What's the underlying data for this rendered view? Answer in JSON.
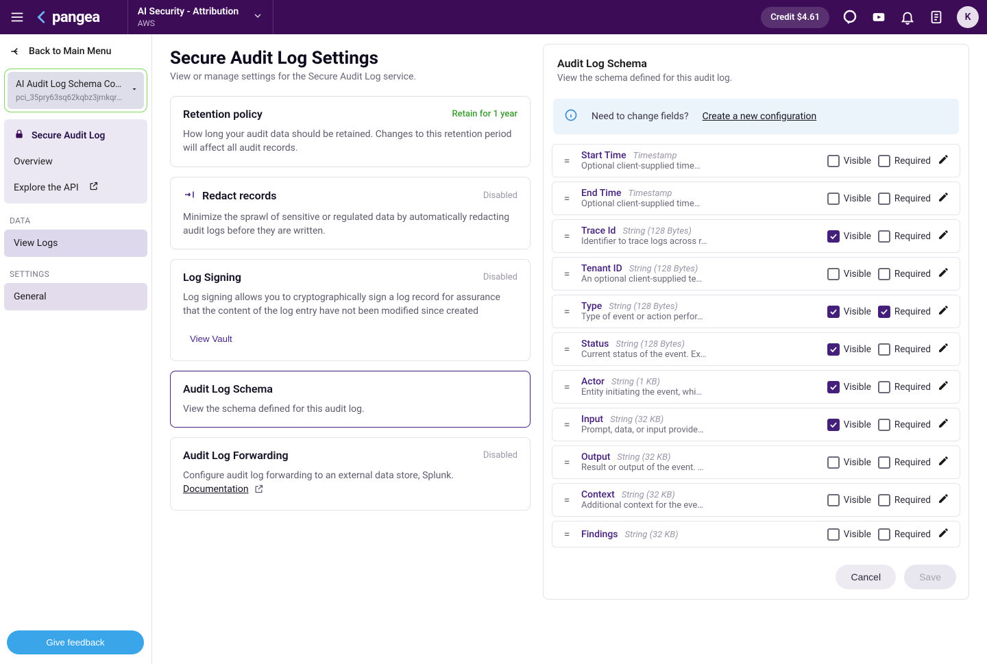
{
  "topbar": {
    "project_title": "AI Security - Attribution",
    "project_sub": "AWS",
    "credit_label": "Credit $4.61",
    "avatar_initial": "K"
  },
  "sidebar": {
    "back_label": "Back to Main Menu",
    "config_name": "AI Audit Log Schema Conf…",
    "config_id": "pci_35pry63sq62kqbz3jmkqrp…",
    "service_label": "Secure Audit Log",
    "overview_label": "Overview",
    "explore_label": "Explore the API",
    "section_data": "DATA",
    "view_logs": "View Logs",
    "section_settings": "SETTINGS",
    "general": "General",
    "feedback": "Give feedback"
  },
  "page": {
    "title": "Secure Audit Log Settings",
    "subtitle": "View or manage settings for the Secure Audit Log service."
  },
  "cards": {
    "retention": {
      "title": "Retention policy",
      "badge": "Retain for 1 year",
      "desc": "How long your audit data should be retained. Changes to this retention period will affect all audit records."
    },
    "redact": {
      "title": "Redact records",
      "badge": "Disabled",
      "desc": "Minimize the sprawl of sensitive or regulated data by automatically redacting audit logs before they are written."
    },
    "signing": {
      "title": "Log Signing",
      "badge": "Disabled",
      "desc": "Log signing allows you to cryptographically sign a log record for assurance that the content of the log entry have not been modified since created",
      "action": "View Vault"
    },
    "schema": {
      "title": "Audit Log Schema",
      "desc": "View the schema defined for this audit log."
    },
    "forwarding": {
      "title": "Audit Log Forwarding",
      "badge": "Disabled",
      "desc_prefix": "Configure audit log forwarding to an external data store, Splunk. ",
      "doc_label": "Documentation"
    }
  },
  "panel": {
    "title": "Audit Log Schema",
    "subtitle": "View the schema defined for this audit log.",
    "banner_text": "Need to change fields?",
    "banner_link": "Create a new configuration",
    "visible_label": "Visible",
    "required_label": "Required",
    "cancel": "Cancel",
    "save": "Save",
    "fields": [
      {
        "name": "Start Time",
        "type": "Timestamp",
        "desc": "Optional client-supplied time…",
        "visible": false,
        "required": false
      },
      {
        "name": "End Time",
        "type": "Timestamp",
        "desc": "Optional client-supplied time…",
        "visible": false,
        "required": false
      },
      {
        "name": "Trace Id",
        "type": "String (128 Bytes)",
        "desc": "Identifier to trace logs across r…",
        "visible": true,
        "required": false
      },
      {
        "name": "Tenant ID",
        "type": "String (128 Bytes)",
        "desc": "An optional client-supplied te…",
        "visible": false,
        "required": false
      },
      {
        "name": "Type",
        "type": "String (128 Bytes)",
        "desc": "Type of event or action perfor…",
        "visible": true,
        "required": true
      },
      {
        "name": "Status",
        "type": "String (128 Bytes)",
        "desc": "Current status of the event. Ex…",
        "visible": true,
        "required": false
      },
      {
        "name": "Actor",
        "type": "String (1 KB)",
        "desc": "Entity initiating the event, whi…",
        "visible": true,
        "required": false
      },
      {
        "name": "Input",
        "type": "String (32 KB)",
        "desc": "Prompt, data, or input provide…",
        "visible": true,
        "required": false
      },
      {
        "name": "Output",
        "type": "String (32 KB)",
        "desc": "Result or output of the event. …",
        "visible": false,
        "required": false
      },
      {
        "name": "Context",
        "type": "String (32 KB)",
        "desc": "Additional context for the eve…",
        "visible": false,
        "required": false
      },
      {
        "name": "Findings",
        "type": "String (32 KB)",
        "desc": "",
        "visible": false,
        "required": false
      }
    ]
  }
}
